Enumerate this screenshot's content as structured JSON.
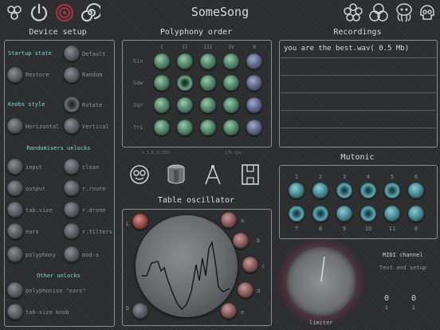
{
  "app_title": "SomeSong",
  "top_icons": {
    "left": [
      "brain-icon",
      "power-icon",
      "spiral-red-icon",
      "spiral-icon"
    ],
    "right": [
      "flower-icon",
      "circles-icon",
      "octopus-icon",
      "skull-icon"
    ]
  },
  "device_setup": {
    "title": "Device setup",
    "startup_state_label": "Startup state",
    "default_label": "Default",
    "restore_label": "Restore",
    "random_label": "Random",
    "knobs_style_label": "Knobs style",
    "rotate_label": "Rotate",
    "horizontal_label": "Horizontal",
    "vertical_label": "Vertical",
    "randomisers_unlocks_label": "Randomisers unlocks",
    "randomisers": [
      {
        "left": "input",
        "right": "clean"
      },
      {
        "left": "output",
        "right": "r.route"
      },
      {
        "left": "tab.size",
        "right": "r.drone"
      },
      {
        "left": "ears",
        "right": "r.filters"
      },
      {
        "left": "polyphony",
        "right": "mod-s"
      }
    ],
    "other_unlocks_label": "Other unlocks",
    "polyphonise_label": "polyphonise \"ears\"",
    "tabsize_knob_label": "tab-size knob"
  },
  "polyphony": {
    "title": "Polyphony order",
    "columns": [
      "I",
      "II",
      "III",
      "IV",
      "N"
    ],
    "rows": [
      "Sin",
      "Saw",
      "Sqr",
      "Tri"
    ],
    "version": "v.1.0.3(255)",
    "cpu": "17% cpu"
  },
  "mid_icons": [
    "brain-outline-icon",
    "drum-icon",
    "compass-icon",
    "table-icon"
  ],
  "table_oscillator": {
    "title": "Table oscillator",
    "left_labels": [
      "L",
      "D"
    ],
    "right_labels": [
      "a",
      "b",
      "c",
      "d",
      "e"
    ]
  },
  "recordings": {
    "title": "Recordings",
    "items": [
      "you are the best.wav( 0.5 Mb)"
    ]
  },
  "mutonic": {
    "title": "Mutonic",
    "top_numbers": [
      "1",
      "2",
      "3",
      "4",
      "5",
      "6"
    ],
    "bottom_numbers": [
      "7",
      "8",
      "9",
      "10",
      "11",
      "0"
    ]
  },
  "midi": {
    "title": "MIDI channel",
    "test_setup": "Test and setup",
    "values": [
      "0",
      "0"
    ],
    "sub_values": [
      "1",
      "1"
    ]
  },
  "limiter_label": "limiter",
  "colors": {
    "background": "#2c2d2f",
    "accent_cyan": "#7fd9cf",
    "panel_border": "#8a8c8e"
  }
}
